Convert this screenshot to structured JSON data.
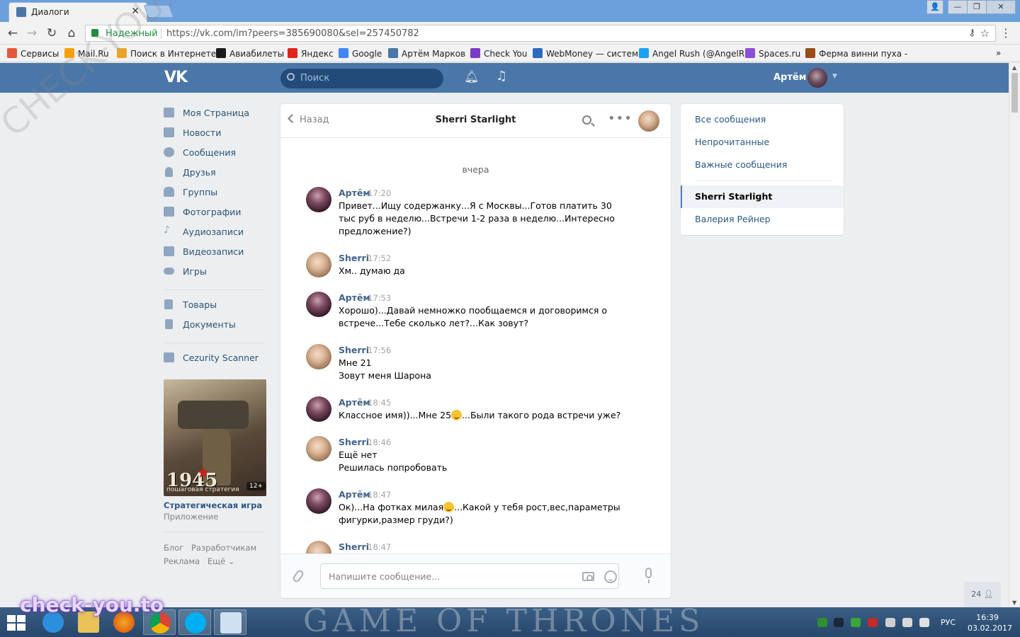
{
  "browser": {
    "tab_title": "Диалоги",
    "tab_close": "✕",
    "secure_label": "Надежный",
    "url": "https://vk.com/im?peers=385690080&sel=257450782",
    "bookmarks": [
      {
        "label": "Сервисы",
        "color": "#e5573b"
      },
      {
        "label": "Mail.Ru",
        "color": "#f7a00c"
      },
      {
        "label": "Поиск в Интернете",
        "color": "#e8a52a"
      },
      {
        "label": "Авиабилеты",
        "color": "#1a1a1a"
      },
      {
        "label": "Яндекс",
        "color": "#e0251b"
      },
      {
        "label": "Google",
        "color": "#4285f4"
      },
      {
        "label": "Артём Марков",
        "color": "#4a76a8"
      },
      {
        "label": "Check You",
        "color": "#7a3cc6"
      },
      {
        "label": "WebMoney — систем",
        "color": "#2a6bbf"
      },
      {
        "label": "Angel Rush (@AngelR",
        "color": "#1da1f2"
      },
      {
        "label": "Spaces.ru",
        "color": "#8b4fd8"
      },
      {
        "label": "Ферма винни пуха -",
        "color": "#9a4a1a"
      }
    ],
    "more_bookmarks": "»"
  },
  "vk_header": {
    "logo": "VK",
    "search_placeholder": "Поиск",
    "user_name": "Артём"
  },
  "left_menu": {
    "items": [
      "Моя Страница",
      "Новости",
      "Сообщения",
      "Друзья",
      "Группы",
      "Фотографии",
      "Аудиозаписи",
      "Видеозаписи",
      "Игры"
    ],
    "items2": [
      "Товары",
      "Документы"
    ],
    "items3": [
      "Cezurity Scanner"
    ],
    "ad": {
      "year": "1945",
      "subtitle": "пошаговая стратегия",
      "age": "12+",
      "title": "Стратегическая игра",
      "type": "Приложение"
    },
    "footer": [
      "Блог",
      "Разработчикам",
      "Реклама",
      "Ещё ⌄"
    ]
  },
  "chat": {
    "back_label": "Назад",
    "peer_name": "Sherri Starlight",
    "day_label": "вчера",
    "messages": [
      {
        "author": "Артём",
        "time": "17:20",
        "text": "Привет...Ищу содержанку...Я с Москвы...Готов платить 30 тыс руб в неделю...Встречи 1-2 раза в неделю...Интересно предложение?)"
      },
      {
        "author": "Sherri",
        "time": "17:52",
        "text": "Хм.. думаю да"
      },
      {
        "author": "Артём",
        "time": "17:53",
        "text": "Хорошо)...Давай немножко пообщаемся и договоримся о встрече...Тебе сколько лет?...Как зовут?"
      },
      {
        "author": "Sherri",
        "time": "17:56",
        "text": "Мне 21",
        "text2": "Зовут меня Шарона"
      },
      {
        "author": "Артём",
        "time": "18:45",
        "text": "Классное имя))...Мне 25",
        "text_after_emoji": "...Были такого рода встречи уже?"
      },
      {
        "author": "Sherri",
        "time": "18:46",
        "text": "Ещё нет",
        "text2": "Решилась попробовать"
      },
      {
        "author": "Артём",
        "time": "18:47",
        "text": "Ок)...На фотках милая",
        "text_after_emoji": "...Какой у тебя рост,вес,параметры фигурки,размер груди?)"
      },
      {
        "author": "Sherri",
        "time": "18:47",
        "text": ""
      }
    ],
    "composer_placeholder": "Напишите сообщение..."
  },
  "folders": {
    "all": "Все сообщения",
    "unread": "Непрочитанные",
    "important": "Важные сообщения",
    "dialogs": [
      "Sherri Starlight",
      "Валерия Рейнер"
    ]
  },
  "online_count": "24",
  "taskbar": {
    "language": "РУС",
    "time": "16:39",
    "date": "03.02.2017"
  },
  "watermarks": {
    "diagonal": "CHECK-YOU.ME",
    "brand": "check-you.to",
    "taskbar_wallpaper": "GAME OF THRONES"
  }
}
